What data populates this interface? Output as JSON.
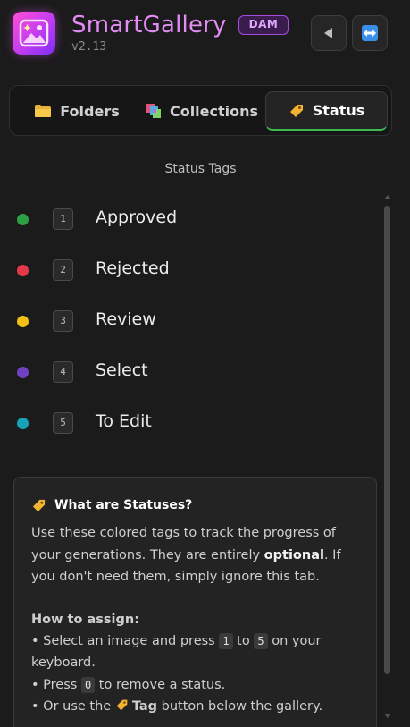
{
  "app": {
    "title": "SmartGallery",
    "version": "v2.13",
    "badge": "DAM"
  },
  "header_buttons": {
    "collapse_icon": "triangle-left-icon",
    "swap_icon": "left-right-arrow-icon"
  },
  "tabs": [
    {
      "label": "Folders",
      "icon": "folder-icon",
      "active": false
    },
    {
      "label": "Collections",
      "icon": "collections-icon",
      "active": false
    },
    {
      "label": "Status",
      "icon": "tag-icon",
      "active": true
    }
  ],
  "section_title": "Status Tags",
  "statuses": [
    {
      "key": "1",
      "label": "Approved",
      "color": "#2ea043"
    },
    {
      "key": "2",
      "label": "Rejected",
      "color": "#e5394b"
    },
    {
      "key": "3",
      "label": "Review",
      "color": "#f5c016"
    },
    {
      "key": "4",
      "label": "Select",
      "color": "#6f42c1"
    },
    {
      "key": "5",
      "label": "To Edit",
      "color": "#17a2b8"
    }
  ],
  "info": {
    "title": "What are Statuses?",
    "intro_1": "Use these colored tags to track the progress of your generations. They are entirely ",
    "intro_bold": "optional",
    "intro_2": ". If you don't need them, simply ignore this tab.",
    "how_title": "How to assign:",
    "b1_a": "• Select an image and press ",
    "b1_k1": "1",
    "b1_mid": " to ",
    "b1_k2": "5",
    "b1_b": " on your keyboard.",
    "b2_a": "• Press ",
    "b2_k": "0",
    "b2_b": " to remove a status.",
    "b3_a": "• Or use the ",
    "b3_bold": "Tag",
    "b3_b": " button below the gallery."
  },
  "colors": {
    "accent": "#3fb950",
    "brand": "#e38cf5"
  }
}
